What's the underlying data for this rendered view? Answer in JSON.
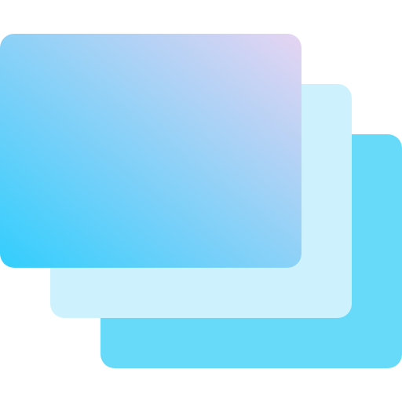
{
  "icon": {
    "name": "stacked-cards-icon",
    "colors": {
      "back_card": "#66daf8",
      "middle_card": "#cdf1fd",
      "front_gradient_start": "#32cefd",
      "front_gradient_end": "#e6d4f2"
    }
  }
}
